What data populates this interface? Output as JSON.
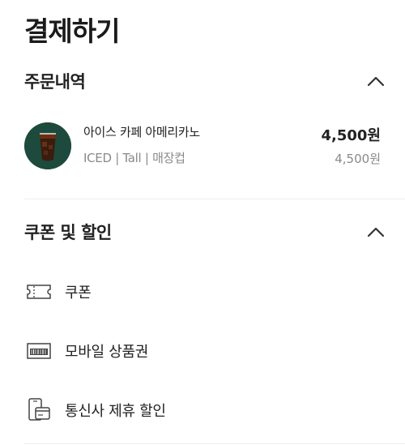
{
  "page": {
    "title": "결제하기"
  },
  "order_section": {
    "title": "주문내역",
    "item": {
      "name": "아이스 카페 아메리카노",
      "options": "ICED | Tall | 매장컵",
      "price": "4,500원",
      "subprice": "4,500원"
    }
  },
  "discount_section": {
    "title": "쿠폰 및 할인",
    "options": [
      {
        "label": "쿠폰",
        "icon": "coupon-ticket-icon"
      },
      {
        "label": "모바일 상품권",
        "icon": "mobile-gift-card-icon"
      },
      {
        "label": "통신사 제휴 할인",
        "icon": "telecom-phone-card-icon"
      }
    ]
  },
  "colors": {
    "thumb_bg": "#1d4a3d",
    "text": "#222222",
    "muted": "#8a8a8a",
    "divider": "#efefef"
  }
}
